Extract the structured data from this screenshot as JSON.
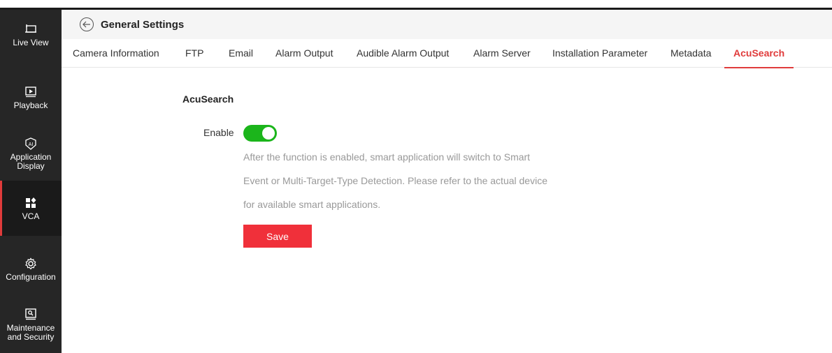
{
  "sidebar": {
    "items": [
      {
        "label": "Live View",
        "icon": "monitor-icon"
      },
      {
        "label": "Playback",
        "icon": "play-icon"
      },
      {
        "label": "Application\nDisplay",
        "icon": "ai-icon"
      },
      {
        "label": "VCA",
        "icon": "grid-icon"
      },
      {
        "label": "Configuration",
        "icon": "gear-icon"
      },
      {
        "label": "Maintenance\nand Security",
        "icon": "maintenance-icon"
      }
    ],
    "active_index": 3
  },
  "header": {
    "title": "General Settings"
  },
  "tabs": [
    {
      "label": "Camera Information"
    },
    {
      "label": "FTP"
    },
    {
      "label": "Email"
    },
    {
      "label": "Alarm Output"
    },
    {
      "label": "Audible Alarm Output"
    },
    {
      "label": "Alarm Server"
    },
    {
      "label": "Installation Parameter"
    },
    {
      "label": "Metadata"
    },
    {
      "label": "AcuSearch"
    }
  ],
  "active_tab": "AcuSearch",
  "content": {
    "section_title": "AcuSearch",
    "enable_label": "Enable",
    "enable_on": true,
    "description_lines": [
      "After the function is enabled, smart application will switch to Smart",
      "Event or Multi-Target-Type Detection. Please refer to the actual device",
      "for available smart applications."
    ],
    "save_label": "Save"
  },
  "colors": {
    "accent": "#e03b3b",
    "toggle_on": "#1bb51b",
    "save_button": "#f0303a",
    "sidebar_bg": "#262626"
  }
}
